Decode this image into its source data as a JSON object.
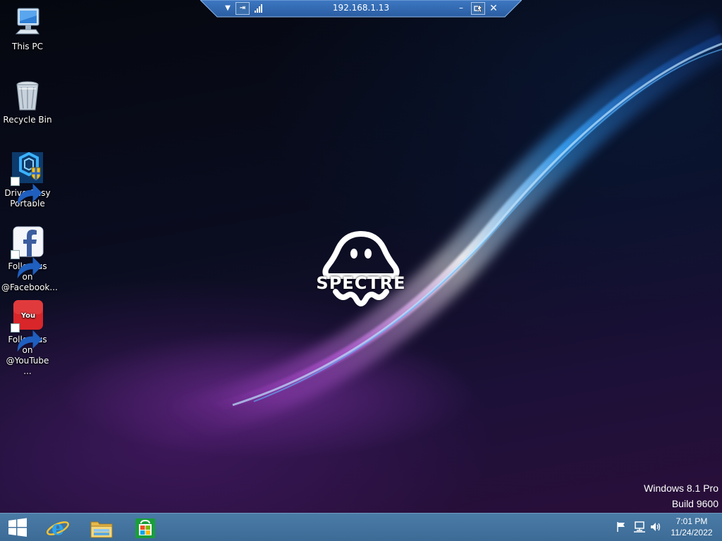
{
  "remote_bar": {
    "title": "192.168.1.13",
    "menu_glyph": "▼",
    "pin_glyph": "⇥",
    "minimize_glyph": "–",
    "close_glyph": "✕",
    "signal_icon": "signal-bars-icon",
    "bar_color": "#2f63a8"
  },
  "desktop": {
    "icons": [
      {
        "label": "This PC",
        "icon": "computer-icon"
      },
      {
        "label": "Recycle Bin",
        "icon": "recycle-bin-icon"
      },
      {
        "label": "DriverEasy Portable",
        "icon": "drivereasy-icon",
        "shortcut": true
      },
      {
        "label": "Follow us on @Facebook...",
        "icon": "facebook-icon",
        "shortcut": true
      },
      {
        "label": "Follow us on @YouTube ...",
        "icon": "youtube-icon",
        "shortcut": true
      }
    ],
    "logo_text": "SPECTRE",
    "watermark": {
      "line1": "Windows 8.1 Pro",
      "line2": "Build 9600"
    }
  },
  "taskbar": {
    "color": "#3f6e99",
    "pinned": [
      "start-icon",
      "internet-explorer-icon",
      "file-explorer-icon",
      "store-icon"
    ],
    "tray": [
      "flag-icon",
      "network-icon",
      "volume-icon"
    ],
    "clock": {
      "time": "7:01 PM",
      "date": "11/24/2022"
    }
  }
}
